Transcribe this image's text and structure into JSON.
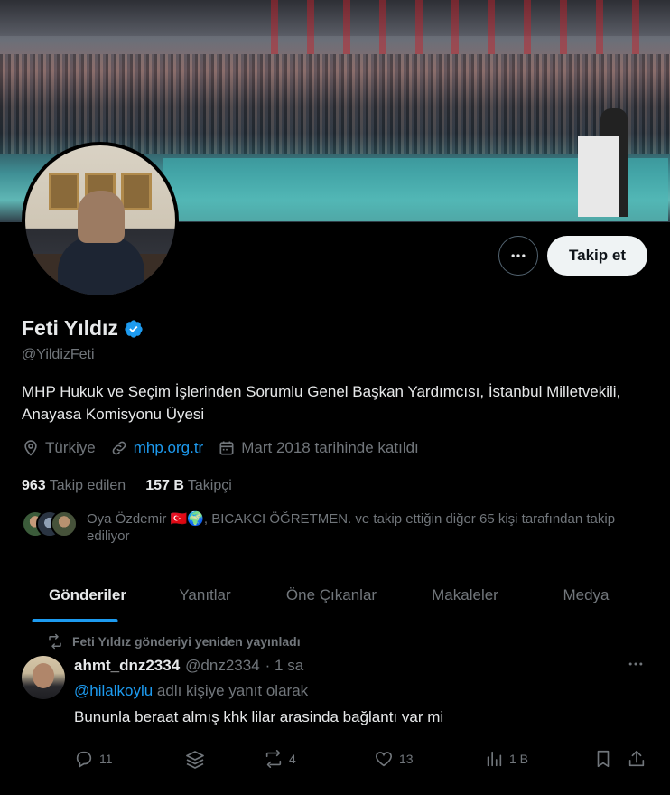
{
  "profile": {
    "name": "Feti Yıldız",
    "handle": "@YildizFeti",
    "bio": "MHP Hukuk ve Seçim İşlerinden Sorumlu Genel Başkan Yardımcısı, İstanbul Milletvekili, Anayasa Komisyonu Üyesi",
    "location": "Türkiye",
    "website": "mhp.org.tr",
    "joined": "Mart 2018 tarihinde katıldı",
    "following_count": "963",
    "following_label": "Takip edilen",
    "followers_count": "157 B",
    "followers_label": "Takipçi",
    "followed_by_text": "Oya Özdemir 🇹🇷🌍, BICAKCI ÖĞRETMEN. ve takip ettiğin diğer 65 kişi tarafından takip ediliyor",
    "follow_button": "Takip et",
    "verified_color": "#1d9bf0"
  },
  "tabs": [
    {
      "label": "Gönderiler",
      "active": true
    },
    {
      "label": "Yanıtlar",
      "active": false
    },
    {
      "label": "Öne Çıkanlar",
      "active": false
    },
    {
      "label": "Makaleler",
      "active": false
    },
    {
      "label": "Medya",
      "active": false
    }
  ],
  "post": {
    "repost_notice": "Feti Yıldız gönderiyi yeniden yayınladı",
    "author_name": "ahmt_dnz2334",
    "author_handle": "@dnz2334",
    "time": "· 1 sa",
    "reply_handle": "@hilalkoylu",
    "reply_suffix": " adlı kişiye yanıt olarak",
    "text": "Bununla beraat almış khk lilar arasinda bağlantı var mi",
    "replies": "11",
    "reposts": "4",
    "likes": "13",
    "views": "1 B"
  }
}
